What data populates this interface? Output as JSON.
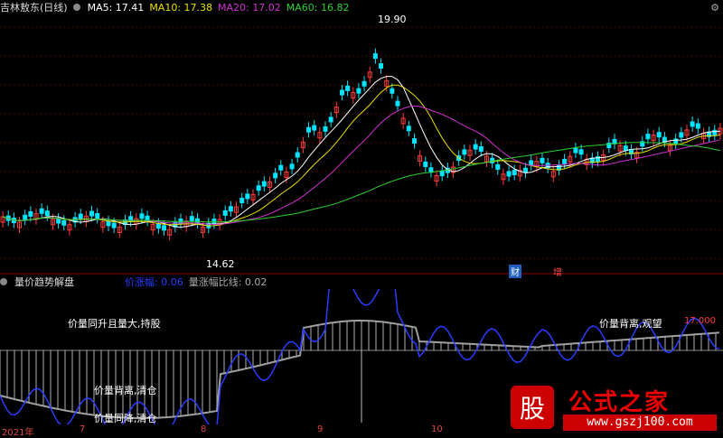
{
  "header": {
    "stock": "吉林敖东(日线)",
    "ma5": "MA5: 17.41",
    "ma10": "MA10: 17.38",
    "ma20": "MA20: 17.02",
    "ma60": "MA60: 16.82"
  },
  "sub_header": {
    "indicator": "量价趋势解盘",
    "price_rise": "价涨幅: 0.06",
    "vol_rise": "量涨幅比线: 0.02"
  },
  "annotations": {
    "high": "19.90",
    "low": "14.62",
    "hold": "价量同升且量大,持股",
    "watch": "价量背离,观望",
    "clear1": "价量背离,清仓",
    "clear2": "价量同降,清仓",
    "val17": "17.000",
    "badge_cai": "财",
    "badge_zeng": "增"
  },
  "xaxis": [
    "2021年",
    "7",
    "8",
    "9",
    "10"
  ],
  "watermark": {
    "shield": "股",
    "title": "公式之家",
    "url": "www.gszj100.com"
  },
  "colors": {
    "up": "#ff3b3b",
    "down": "#00e5ff",
    "ma5": "#ffffff",
    "ma10": "#e8e000",
    "ma20": "#d030d0",
    "ma60": "#30d030",
    "sub_line": "#2a3cff",
    "sub_gray": "#a0a0a0"
  }
}
